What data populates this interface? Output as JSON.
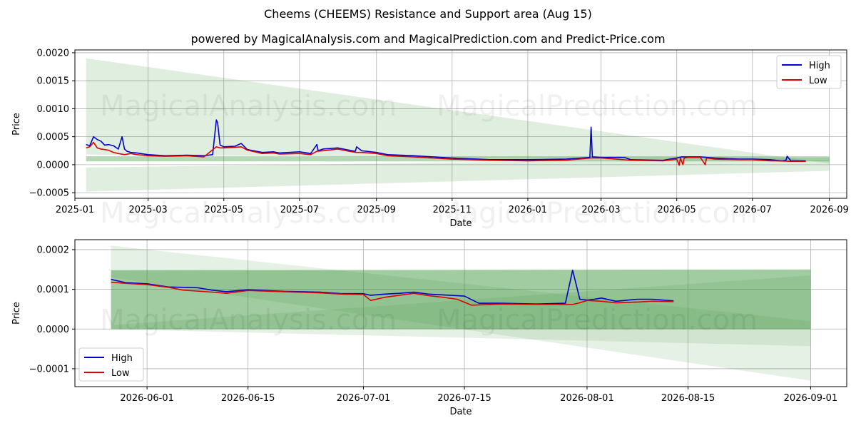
{
  "title": "Cheems (CHEEMS) Resistance and Support area (Aug 15)",
  "subtitle": "powered by MagicalAnalysis.com and MagicalPrediction.com and Predict-Price.com",
  "watermark": [
    "MagicalAnalysis.com",
    "MagicalPrediction.com"
  ],
  "colors": {
    "high": "#0000cc",
    "low": "#dd0000",
    "band": "#2e8b2e",
    "grid": "#b0b0b0"
  },
  "chart_data": [
    {
      "type": "line",
      "xlabel": "Date",
      "ylabel": "Price",
      "xlim": [
        "2025-01-01",
        "2026-09-15"
      ],
      "ylim": [
        -0.0006,
        0.00205
      ],
      "xticks": [
        "2025-01",
        "2025-03",
        "2025-05",
        "2025-07",
        "2025-09",
        "2025-11",
        "2026-01",
        "2026-03",
        "2026-05",
        "2026-07",
        "2026-09"
      ],
      "yticks": [
        -0.0005,
        0.0,
        0.0005,
        0.001,
        0.0015,
        0.002
      ],
      "ytick_labels": [
        "−0.0005",
        "0.0000",
        "0.0005",
        "0.0010",
        "0.0015",
        "0.0020"
      ],
      "grid": true,
      "legend": {
        "position": "top-right",
        "entries": [
          "High",
          "Low"
        ]
      },
      "bands": [
        {
          "x": [
            "2025-01-10",
            "2026-09-01"
          ],
          "upper": [
            0.0019,
            2e-05
          ],
          "lower": [
            0.00018,
            8e-05
          ]
        },
        {
          "x": [
            "2025-01-10",
            "2026-09-01"
          ],
          "upper": [
            -5e-05,
            0.00013
          ],
          "lower": [
            -0.00048,
            -0.00011
          ]
        },
        {
          "x": [
            "2025-01-10",
            "2026-09-01"
          ],
          "upper": [
            0.00015,
            0.00015
          ],
          "lower": [
            6e-05,
            6e-05
          ]
        }
      ],
      "series": [
        {
          "name": "High",
          "x": [
            "2025-01-10",
            "2025-01-13",
            "2025-01-16",
            "2025-01-19",
            "2025-01-22",
            "2025-01-25",
            "2025-01-28",
            "2025-02-01",
            "2025-02-05",
            "2025-02-08",
            "2025-02-10",
            "2025-02-12",
            "2025-02-15",
            "2025-02-20",
            "2025-03-01",
            "2025-03-15",
            "2025-04-01",
            "2025-04-15",
            "2025-04-22",
            "2025-04-25",
            "2025-04-26",
            "2025-04-28",
            "2025-05-01",
            "2025-05-10",
            "2025-05-15",
            "2025-05-20",
            "2025-06-01",
            "2025-06-10",
            "2025-06-15",
            "2025-07-01",
            "2025-07-10",
            "2025-07-15",
            "2025-07-16",
            "2025-07-20",
            "2025-08-01",
            "2025-08-10",
            "2025-08-15",
            "2025-08-16",
            "2025-08-20",
            "2025-09-01",
            "2025-09-10",
            "2025-10-01",
            "2025-11-01",
            "2025-12-01",
            "2026-01-01",
            "2026-02-01",
            "2026-02-20",
            "2026-02-21",
            "2026-02-22",
            "2026-03-01",
            "2026-03-20",
            "2026-03-25",
            "2026-04-20",
            "2026-05-01",
            "2026-05-05",
            "2026-05-10",
            "2026-05-20",
            "2026-06-01",
            "2026-06-20",
            "2026-07-01",
            "2026-07-15",
            "2026-07-20",
            "2026-07-25",
            "2026-07-28",
            "2026-07-29",
            "2026-08-01",
            "2026-08-10",
            "2026-08-13"
          ],
          "values": [
            0.00036,
            0.00034,
            0.0005,
            0.00045,
            0.00042,
            0.00035,
            0.00036,
            0.00034,
            0.00028,
            0.0005,
            0.00028,
            0.00024,
            0.00022,
            0.00021,
            0.00018,
            0.00016,
            0.00017,
            0.00016,
            0.00018,
            0.0008,
            0.00075,
            0.00035,
            0.00032,
            0.00033,
            0.00038,
            0.00027,
            0.00022,
            0.00023,
            0.00021,
            0.00023,
            0.0002,
            0.00036,
            0.00025,
            0.00028,
            0.0003,
            0.00026,
            0.00024,
            0.00032,
            0.00025,
            0.00022,
            0.00018,
            0.00016,
            0.00012,
            9e-05,
            9e-05,
            0.0001,
            0.00013,
            0.00067,
            0.00014,
            0.00013,
            0.00013,
            9e-05,
            8e-05,
            0.00012,
            0.00014,
            0.00014,
            0.00014,
            0.00012,
            0.0001,
            0.0001,
            9e-05,
            8e-05,
            7e-05,
            8e-05,
            0.00015,
            7e-05,
            7e-05,
            7e-05
          ]
        },
        {
          "name": "Low",
          "x": [
            "2025-01-10",
            "2025-01-13",
            "2025-01-16",
            "2025-01-19",
            "2025-01-22",
            "2025-01-25",
            "2025-01-28",
            "2025-02-01",
            "2025-02-05",
            "2025-02-10",
            "2025-02-15",
            "2025-02-20",
            "2025-03-01",
            "2025-03-15",
            "2025-04-01",
            "2025-04-15",
            "2025-04-25",
            "2025-04-28",
            "2025-05-01",
            "2025-05-10",
            "2025-05-15",
            "2025-05-20",
            "2025-06-01",
            "2025-06-10",
            "2025-06-15",
            "2025-07-01",
            "2025-07-10",
            "2025-07-15",
            "2025-07-20",
            "2025-08-01",
            "2025-08-10",
            "2025-08-15",
            "2025-08-20",
            "2025-09-01",
            "2025-09-10",
            "2025-10-01",
            "2025-11-01",
            "2025-12-01",
            "2026-01-01",
            "2026-02-01",
            "2026-02-21",
            "2026-03-01",
            "2026-03-25",
            "2026-04-20",
            "2026-05-01",
            "2026-05-03",
            "2026-05-04",
            "2026-05-06",
            "2026-05-07",
            "2026-05-10",
            "2026-05-20",
            "2026-05-24",
            "2026-05-25",
            "2026-06-01",
            "2026-06-20",
            "2026-07-01",
            "2026-07-15",
            "2026-07-20",
            "2026-08-01",
            "2026-08-13"
          ],
          "values": [
            0.0003,
            0.00032,
            0.0004,
            0.0003,
            0.00028,
            0.00027,
            0.00026,
            0.00022,
            0.0002,
            0.00018,
            0.0002,
            0.00018,
            0.00016,
            0.00015,
            0.00016,
            0.00014,
            0.00032,
            0.0003,
            0.0003,
            0.00031,
            0.00032,
            0.00026,
            0.0002,
            0.00021,
            0.00019,
            0.0002,
            0.00018,
            0.00024,
            0.00025,
            0.00028,
            0.00024,
            0.00022,
            0.00022,
            0.0002,
            0.00016,
            0.00014,
            0.0001,
            8e-05,
            7e-05,
            8e-05,
            0.00012,
            0.00012,
            8e-05,
            7e-05,
            0.0001,
            -1e-05,
            0.00012,
            0.0,
            0.00012,
            0.00013,
            0.00013,
            0.0,
            0.00012,
            0.0001,
            9e-05,
            9e-05,
            7e-05,
            7e-05,
            6e-05,
            6e-05
          ]
        }
      ]
    },
    {
      "type": "line",
      "xlabel": "Date",
      "ylabel": "Price",
      "xlim": [
        "2026-05-22",
        "2026-09-06"
      ],
      "ylim": [
        -0.000145,
        0.000225
      ],
      "xticks": [
        "2026-06-01",
        "2026-06-15",
        "2026-07-01",
        "2026-07-15",
        "2026-08-01",
        "2026-08-15",
        "2026-09-01"
      ],
      "yticks": [
        -0.0001,
        0.0,
        0.0001,
        0.0002
      ],
      "ytick_labels": [
        "−0.0001",
        "0.0000",
        "0.0001",
        "0.0002"
      ],
      "grid": true,
      "legend": {
        "position": "bottom-left",
        "entries": [
          "High",
          "Low"
        ]
      },
      "bands": [
        {
          "x": [
            "2026-05-27",
            "2026-09-01"
          ],
          "upper": [
            0.00021,
            2e-05
          ],
          "lower": [
            0.00013,
            -0.00013
          ]
        },
        {
          "x": [
            "2026-05-27",
            "2026-09-01"
          ],
          "upper": [
            0.000148,
            0.00015
          ],
          "lower": [
            0.0,
            0.0
          ]
        },
        {
          "x": [
            "2026-05-27",
            "2026-09-01"
          ],
          "upper": [
            1e-05,
            0.000135
          ],
          "lower": [
            -5e-07,
            -4.3e-05
          ]
        }
      ],
      "series": [
        {
          "name": "High",
          "x": [
            "2026-05-27",
            "2026-05-29",
            "2026-06-01",
            "2026-06-04",
            "2026-06-08",
            "2026-06-10",
            "2026-06-12",
            "2026-06-15",
            "2026-06-20",
            "2026-06-25",
            "2026-06-28",
            "2026-07-01",
            "2026-07-02",
            "2026-07-04",
            "2026-07-06",
            "2026-07-08",
            "2026-07-10",
            "2026-07-15",
            "2026-07-17",
            "2026-07-20",
            "2026-07-25",
            "2026-07-29",
            "2026-07-30",
            "2026-07-31",
            "2026-08-01",
            "2026-08-02",
            "2026-08-03",
            "2026-08-05",
            "2026-08-08",
            "2026-08-10",
            "2026-08-13"
          ],
          "values": [
            0.000125,
            0.000117,
            0.000114,
            0.000106,
            0.000104,
            9.8e-05,
            9.4e-05,
            9.9e-05,
            9.5e-05,
            9.3e-05,
            8.9e-05,
            8.9e-05,
            8.5e-05,
            8.8e-05,
            9e-05,
            9.3e-05,
            8.8e-05,
            8.3e-05,
            6.5e-05,
            6.5e-05,
            6.3e-05,
            6.5e-05,
            0.000148,
            7.5e-05,
            7.3e-05,
            7.5e-05,
            7.8e-05,
            7e-05,
            7.5e-05,
            7.5e-05,
            7.1e-05
          ]
        },
        {
          "name": "Low",
          "x": [
            "2026-05-27",
            "2026-05-29",
            "2026-06-01",
            "2026-06-04",
            "2026-06-06",
            "2026-06-10",
            "2026-06-12",
            "2026-06-15",
            "2026-06-20",
            "2026-06-25",
            "2026-06-28",
            "2026-07-01",
            "2026-07-02",
            "2026-07-04",
            "2026-07-06",
            "2026-07-08",
            "2026-07-10",
            "2026-07-12",
            "2026-07-14",
            "2026-07-16",
            "2026-07-20",
            "2026-07-25",
            "2026-07-30",
            "2026-07-31",
            "2026-08-01",
            "2026-08-03",
            "2026-08-05",
            "2026-08-08",
            "2026-08-10",
            "2026-08-13"
          ],
          "values": [
            0.000118,
            0.000115,
            0.000112,
            0.000105,
            9.8e-05,
            9.3e-05,
            9e-05,
            9.7e-05,
            9.4e-05,
            9.1e-05,
            8.8e-05,
            8.7e-05,
            7.2e-05,
            8e-05,
            8.5e-05,
            9e-05,
            8.4e-05,
            8e-05,
            7.5e-05,
            6e-05,
            6.3e-05,
            6.2e-05,
            6.2e-05,
            6.6e-05,
            7.2e-05,
            7e-05,
            6.6e-05,
            6.8e-05,
            7e-05,
            6.9e-05
          ]
        }
      ]
    }
  ]
}
